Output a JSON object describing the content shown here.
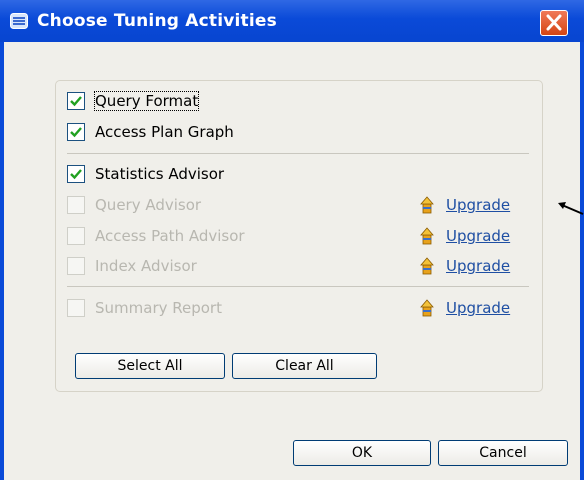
{
  "window": {
    "title": "Choose Tuning Activities"
  },
  "activities": [
    {
      "label": "Query Format",
      "checked": true,
      "enabled": true
    },
    {
      "label": "Access Plan Graph",
      "checked": true,
      "enabled": true
    },
    {
      "label": "Statistics Advisor",
      "checked": true,
      "enabled": true
    },
    {
      "label": "Query Advisor",
      "checked": false,
      "enabled": false,
      "upgrade": "Upgrade"
    },
    {
      "label": "Access Path Advisor",
      "checked": false,
      "enabled": false,
      "upgrade": "Upgrade"
    },
    {
      "label": "Index Advisor",
      "checked": false,
      "enabled": false,
      "upgrade": "Upgrade"
    },
    {
      "label": "Summary Report",
      "checked": false,
      "enabled": false,
      "upgrade": "Upgrade"
    }
  ],
  "buttons": {
    "select_all": "Select All",
    "clear_all": "Clear All",
    "ok": "OK",
    "cancel": "Cancel"
  },
  "colors": {
    "titlebar": "#0a4ad8",
    "check": "#21a121",
    "link": "#1f4fa3",
    "close": "#d54413"
  }
}
